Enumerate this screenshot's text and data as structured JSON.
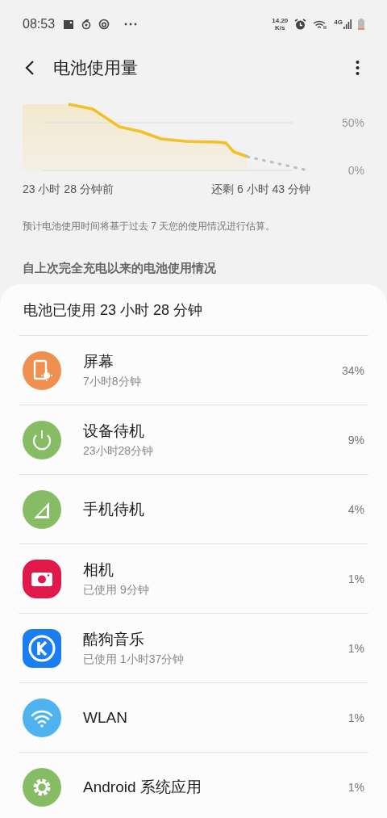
{
  "status_bar": {
    "time": "08:53",
    "speed": "14.20",
    "speed_unit": "K/s",
    "network": "4G"
  },
  "app_bar": {
    "title": "电池使用量"
  },
  "chart": {
    "tick_labels": [
      "50%",
      "0%"
    ],
    "start_label": "23 小时 28 分钟前",
    "end_label": "还剩 6 小时 43 分钟"
  },
  "note": "预计电池使用时间将基于过去 7 天您的使用情况进行估算。",
  "section_title": "自上次完全充电以来的电池使用情况",
  "usage": {
    "summary": "电池已使用 23 小时 28 分钟",
    "items": [
      {
        "kind": "screen",
        "color": "#ef8f50",
        "name": "屏幕",
        "detail": "7小时8分钟",
        "percent": "34%"
      },
      {
        "kind": "power",
        "color": "#86bd64",
        "name": "设备待机",
        "detail": "23小时28分钟",
        "percent": "9%"
      },
      {
        "kind": "signal",
        "color": "#86bd64",
        "name": "手机待机",
        "percent": "4%"
      },
      {
        "kind": "camera",
        "color": "#e0194a",
        "name": "相机",
        "detail": "已使用 9分钟",
        "percent": "1%"
      },
      {
        "kind": "music",
        "color": "#1a7ef0",
        "name": "酷狗音乐",
        "detail": "已使用 1小时37分钟",
        "percent": "1%"
      },
      {
        "kind": "wifi",
        "color": "#4fb3f0",
        "name": "WLAN",
        "percent": "1%"
      },
      {
        "kind": "gear",
        "color": "#86bd64",
        "name": "Android 系统应用",
        "percent": "1%"
      }
    ]
  }
}
